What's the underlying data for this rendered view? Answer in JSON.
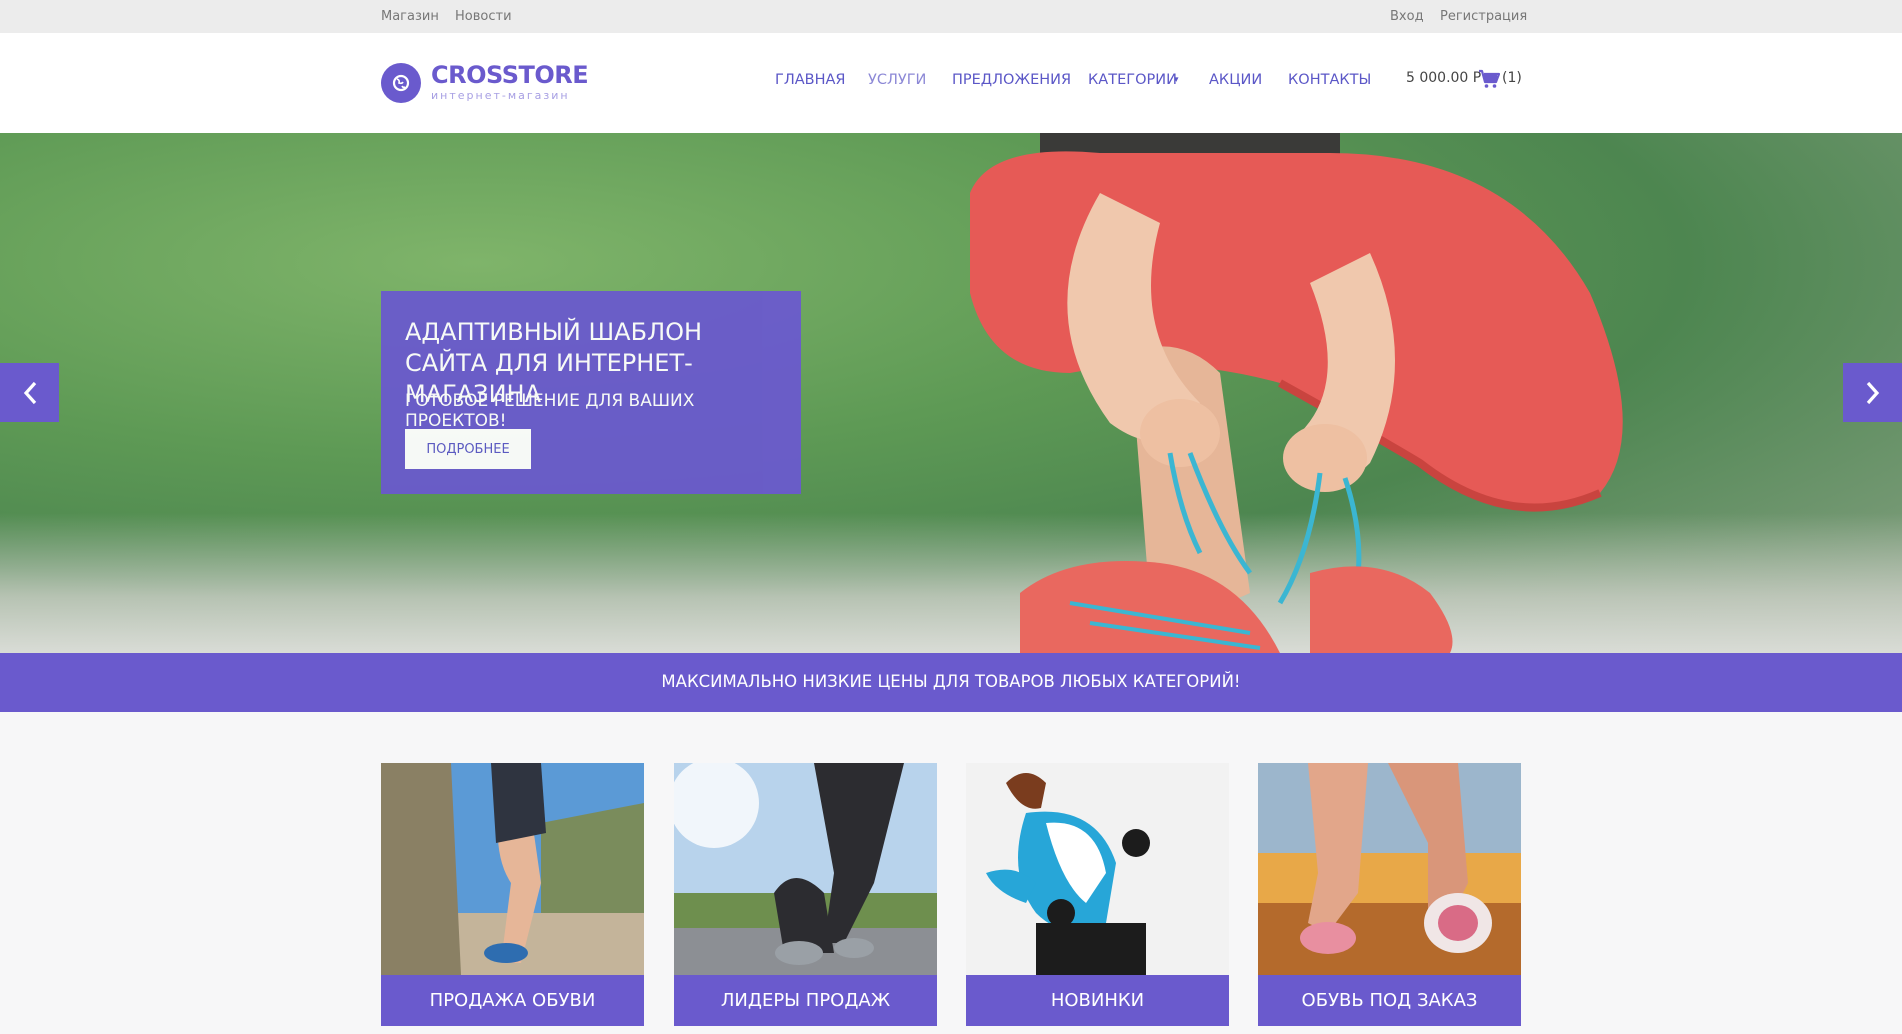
{
  "topbar": {
    "left_links": [
      "Магазин",
      "Новости"
    ],
    "login": "Вход",
    "register": "Регистрация"
  },
  "logo": {
    "title": "CROSSTORE",
    "subtitle": "интернет-магазин"
  },
  "nav": {
    "items": [
      {
        "label": "ГЛАВНАЯ"
      },
      {
        "label": "УСЛУГИ"
      },
      {
        "label": "ПРЕДЛОЖЕНИЯ"
      },
      {
        "label": "КАТЕГОРИИ"
      },
      {
        "label": "АКЦИИ"
      },
      {
        "label": "КОНТАКТЫ"
      }
    ]
  },
  "cart": {
    "total": "5 000.00 Р",
    "count": "(1)"
  },
  "hero": {
    "title": "АДАПТИВНЫЙ ШАБЛОН САЙТА ДЛЯ ИНТЕРНЕТ-МАГАЗИНА",
    "subtitle": "ГОТОВОЕ РЕШЕНИЕ ДЛЯ ВАШИХ ПРОЕКТОВ!",
    "button": "ПОДРОБНЕЕ"
  },
  "promo": {
    "text": "МАКСИМАЛЬНО НИЗКИЕ ЦЕНЫ ДЛЯ ТОВАРОВ ЛЮБЫХ КАТЕГОРИЙ!"
  },
  "cards": [
    {
      "label": "ПРОДАЖА ОБУВИ"
    },
    {
      "label": "ЛИДЕРЫ ПРОДАЖ"
    },
    {
      "label": "НОВИНКИ"
    },
    {
      "label": "ОБУВЬ ПОД ЗАКАЗ"
    }
  ],
  "colors": {
    "accent": "#6a5acd",
    "topbar_bg": "#ececec",
    "page_bg": "#f7f7f8"
  }
}
